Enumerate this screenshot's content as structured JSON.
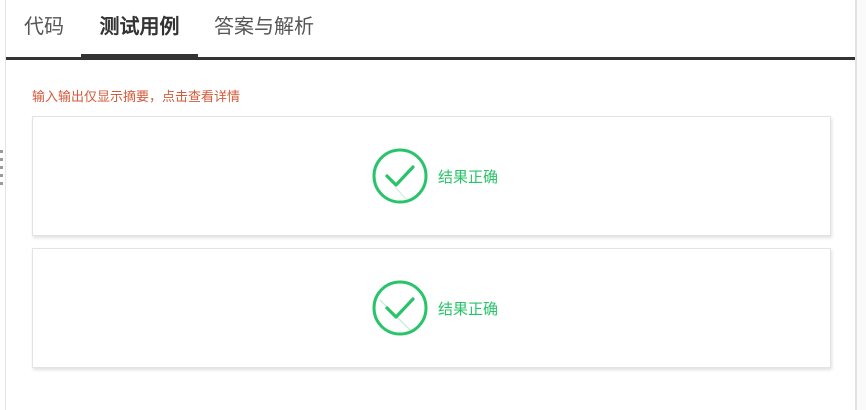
{
  "tabs": [
    {
      "label": "代码",
      "active": false
    },
    {
      "label": "测试用例",
      "active": true
    },
    {
      "label": "答案与解析",
      "active": false
    }
  ],
  "hint": "输入输出仅显示摘要，点击查看详情",
  "test_cases": [
    {
      "result_label": "结果正确",
      "icon": "check-circle-icon"
    },
    {
      "result_label": "结果正确",
      "icon": "check-circle-icon"
    }
  ],
  "colors": {
    "hint": "#d35a3a",
    "success": "#27c469",
    "tab_active_border": "#333333"
  }
}
